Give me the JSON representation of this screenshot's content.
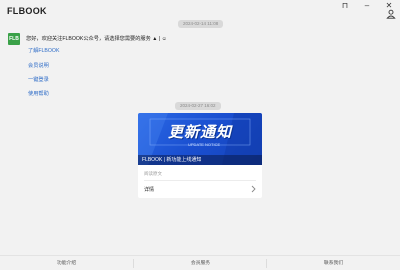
{
  "app": {
    "title": "FLBOOK"
  },
  "window": {
    "pin_glyph": "⊓",
    "minimize_glyph": "–",
    "close_glyph": "✕"
  },
  "icons": {
    "user": "user-icon",
    "chevron": "chevron-right-icon",
    "pin": "pin-icon",
    "minimize": "minimize-icon",
    "close": "close-icon"
  },
  "colors": {
    "accent_link": "#2e6cc7",
    "avatar_bg": "#3aa148",
    "banner": "#1a4fd0"
  },
  "timestamps": [
    "2024-02-14 11:08",
    "2024-02-27 16:02"
  ],
  "message": {
    "avatar_text": "FLB",
    "text": "您好，欢迎关注FLBOOK公众号，请选择您需要的服务 ▲ | ☺",
    "links": [
      "了解FLBOOK",
      "会员说明",
      "一键登录",
      "使用帮助"
    ]
  },
  "card": {
    "banner_title": "更新通知",
    "banner_sub": "UPDATE NOTICE",
    "caption": "FLBOOK | 新功能上线通知",
    "label": "阅读原文",
    "row_label": "详情"
  },
  "bottom_tabs": [
    "功能介绍",
    "会员服务",
    "联系我们"
  ]
}
